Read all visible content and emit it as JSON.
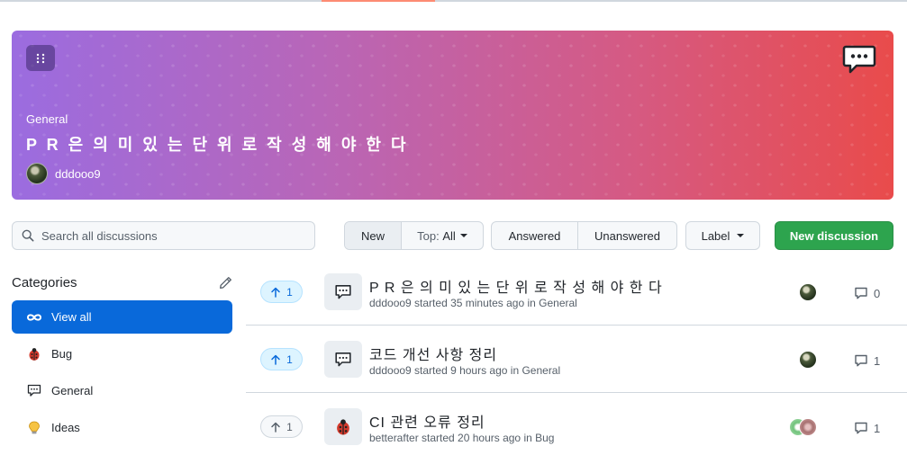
{
  "banner": {
    "category": "General",
    "title": "P R 은 의 미 있 는 단 위 로 작 성 해 야 한 다",
    "author": "dddooo9"
  },
  "search": {
    "placeholder": "Search all discussions"
  },
  "sort": {
    "new_label": "New",
    "top_label": "Top:",
    "top_value": "All"
  },
  "filter": {
    "answered_label": "Answered",
    "unanswered_label": "Unanswered"
  },
  "label_button": "Label",
  "new_discussion_button": "New discussion",
  "sidebar": {
    "heading": "Categories",
    "items": [
      {
        "label": "View all",
        "icon": "infinity-icon"
      },
      {
        "label": "Bug",
        "icon": "ladybug-icon"
      },
      {
        "label": "General",
        "icon": "speech-balloon-icon"
      },
      {
        "label": "Ideas",
        "icon": "lightbulb-icon"
      }
    ]
  },
  "discussions": [
    {
      "votes": "1",
      "title": "P R 은 의 미 있 는 단 위 로 작 성 해 야 한 다",
      "meta": "dddooo9 started 35 minutes ago in General",
      "comments": "0",
      "icon": "speech-balloon-icon"
    },
    {
      "votes": "1",
      "title": "코드 개선 사항 정리",
      "meta": "dddooo9 started 9 hours ago in General",
      "comments": "1",
      "icon": "speech-balloon-icon"
    },
    {
      "votes": "1",
      "title": "CI 관련 오류 정리",
      "meta": "betterafter started 20 hours ago in Bug",
      "comments": "1",
      "icon": "ladybug-icon"
    }
  ],
  "colors": {
    "primary_blue": "#0969da",
    "green_button": "#2da44e",
    "banner_start": "#9b6ce0",
    "banner_end": "#e94b4b"
  }
}
